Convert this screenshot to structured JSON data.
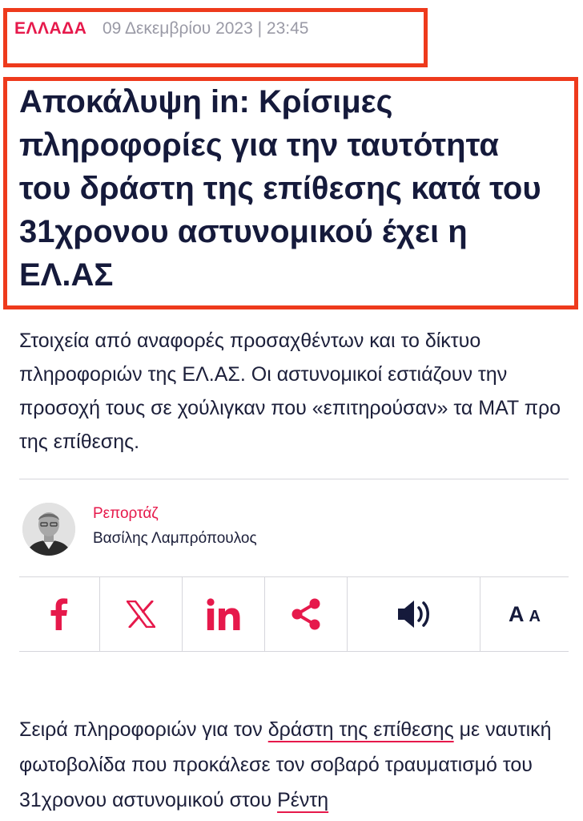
{
  "meta": {
    "category": "ΕΛΛΑΔΑ",
    "date": "09 Δεκεμβρίου 2023 | 23:45"
  },
  "article": {
    "headline": "Αποκάλυψη in: Κρίσιμες πληροφορίες για την ταυτότητα του δράστη της επίθεσης κατά του 31χρονου αστυνομικού έχει η ΕΛ.ΑΣ",
    "lead": "Στοιχεία από αναφορές προσαχθέντων και το δίκτυο πληροφοριών της ΕΛ.ΑΣ. Οι αστυνομικοί εστιάζουν την προσοχή τους σε χούλιγκαν που «επιτηρούσαν» τα ΜΑΤ προ της επίθεσης.",
    "section": "Ρεπορτάζ",
    "author": "Βασίλης Λαμπρόπουλος"
  },
  "share": {
    "icons": [
      "facebook-icon",
      "x-icon",
      "linkedin-icon",
      "share-icon",
      "speaker-icon"
    ],
    "font_large": "A",
    "font_small": "A"
  },
  "body": {
    "p1_a": "Σειρά πληροφοριών για τον ",
    "p1_link1": "δράστη της επίθεσης",
    "p1_b": " με ναυτική φωτοβολίδα που προκάλεσε τον σοβαρό τραυματισμό του 31χρονου αστυνομικού στου ",
    "p1_link2": "Ρέντη"
  },
  "colors": {
    "accent": "#e6194b",
    "highlight_border": "#ee3a1c",
    "text": "#151a3b",
    "muted": "#9a9aa6"
  }
}
